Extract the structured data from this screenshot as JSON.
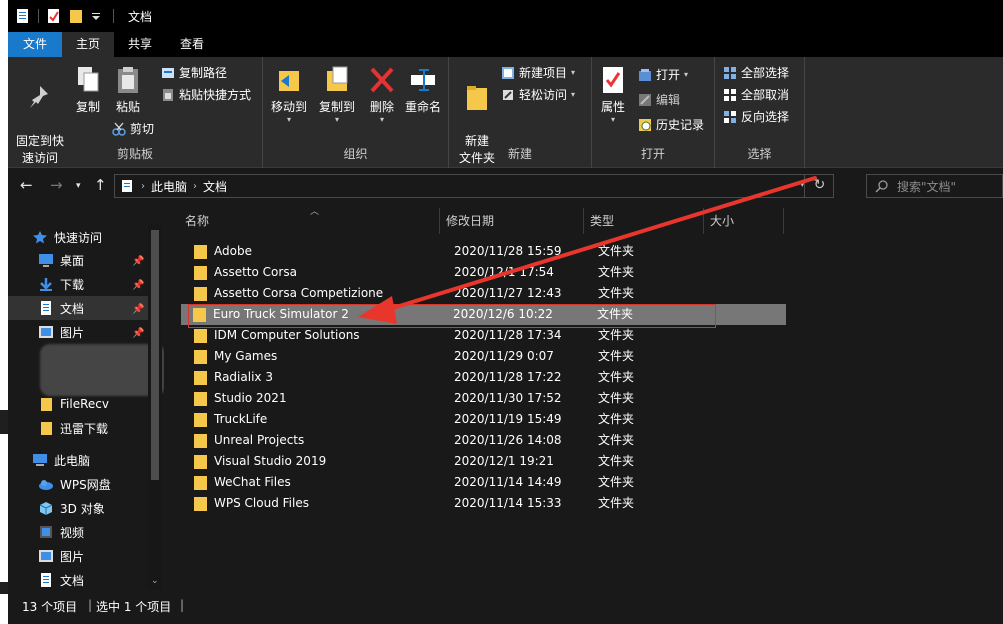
{
  "window": {
    "title": "文档"
  },
  "tabs": [
    {
      "label": "文件"
    },
    {
      "label": "主页"
    },
    {
      "label": "共享"
    },
    {
      "label": "查看"
    }
  ],
  "ribbon": {
    "clipboard": {
      "pin_label": "固定到快\n速访问",
      "copy_label": "复制",
      "paste_label": "粘贴",
      "copy_path_label": "复制路径",
      "paste_shortcut_label": "粘贴快捷方式",
      "cut_label": "剪切",
      "group_label": "剪贴板"
    },
    "organize": {
      "move_to_label": "移动到",
      "copy_to_label": "复制到",
      "delete_label": "删除",
      "rename_label": "重命名",
      "group_label": "组织"
    },
    "new": {
      "new_folder_label": "新建\n文件夹",
      "new_item_label": "新建项目",
      "easy_access_label": "轻松访问",
      "group_label": "新建"
    },
    "open": {
      "properties_label": "属性",
      "open_label": "打开",
      "edit_label": "编辑",
      "history_label": "历史记录",
      "group_label": "打开"
    },
    "select": {
      "select_all_label": "全部选择",
      "select_none_label": "全部取消",
      "invert_label": "反向选择",
      "group_label": "选择"
    }
  },
  "address": {
    "crumbs": [
      "此电脑",
      "文档"
    ],
    "search_placeholder": "搜索\"文档\""
  },
  "nav": {
    "quick_access": "快速访问",
    "items": [
      {
        "label": "桌面",
        "pinned": true
      },
      {
        "label": "下载",
        "pinned": true
      },
      {
        "label": "文档",
        "pinned": true,
        "selected": true
      },
      {
        "label": "图片",
        "pinned": true
      },
      {
        "label": "FileRecv"
      },
      {
        "label": "迅雷下载"
      }
    ],
    "this_pc": "此电脑",
    "pc_items": [
      {
        "label": "WPS网盘"
      },
      {
        "label": "3D 对象"
      },
      {
        "label": "视频"
      },
      {
        "label": "图片"
      },
      {
        "label": "文档"
      }
    ]
  },
  "columns": {
    "name": "名称",
    "date": "修改日期",
    "type": "类型",
    "size": "大小"
  },
  "files": [
    {
      "name": "Adobe",
      "date": "2020/11/28 15:59",
      "type": "文件夹"
    },
    {
      "name": "Assetto Corsa",
      "date": "2020/12/1 17:54",
      "type": "文件夹"
    },
    {
      "name": "Assetto Corsa Competizione",
      "date": "2020/11/27 12:43",
      "type": "文件夹"
    },
    {
      "name": "Euro Truck Simulator 2",
      "date": "2020/12/6 10:22",
      "type": "文件夹",
      "selected": true
    },
    {
      "name": "IDM Computer Solutions",
      "date": "2020/11/28 17:34",
      "type": "文件夹"
    },
    {
      "name": "My Games",
      "date": "2020/11/29 0:07",
      "type": "文件夹"
    },
    {
      "name": "Radialix 3",
      "date": "2020/11/28 17:22",
      "type": "文件夹"
    },
    {
      "name": "Studio 2021",
      "date": "2020/11/30 17:52",
      "type": "文件夹"
    },
    {
      "name": "TruckLife",
      "date": "2020/11/19 15:49",
      "type": "文件夹"
    },
    {
      "name": "Unreal Projects",
      "date": "2020/11/26 14:08",
      "type": "文件夹"
    },
    {
      "name": "Visual Studio 2019",
      "date": "2020/12/1 19:21",
      "type": "文件夹"
    },
    {
      "name": "WeChat Files",
      "date": "2020/11/14 14:49",
      "type": "文件夹"
    },
    {
      "name": "WPS Cloud Files",
      "date": "2020/11/14 15:33",
      "type": "文件夹"
    }
  ],
  "status": {
    "count": "13 个项目",
    "selected": "选中 1 个项目"
  },
  "colors": {
    "accent": "#1979ca",
    "annotation": "#e8362c",
    "folder": "#f5c84c"
  }
}
